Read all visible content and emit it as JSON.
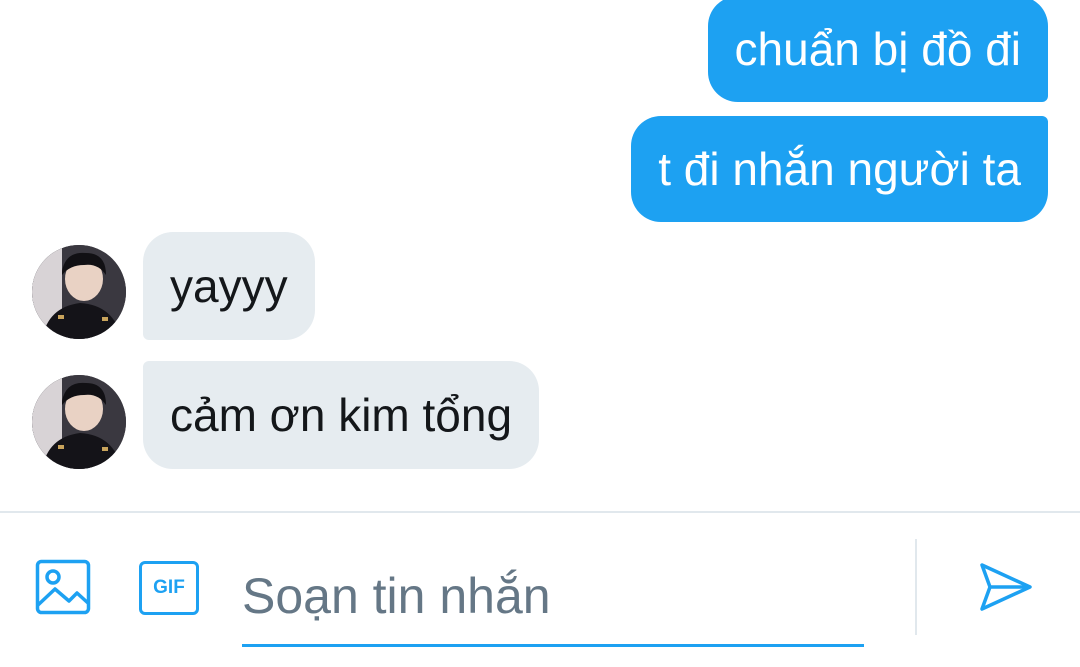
{
  "conversation": {
    "messages": [
      {
        "direction": "out",
        "text": "chuẩn bị đồ đi"
      },
      {
        "direction": "out",
        "text": "t đi nhắn người ta"
      },
      {
        "direction": "in",
        "text": "yayyy",
        "avatar": "avatar"
      },
      {
        "direction": "in",
        "text": "cảm ơn kim tổng",
        "avatar": "avatar"
      }
    ]
  },
  "composer": {
    "placeholder": "Soạn tin nhắn",
    "value": "",
    "image_icon": "image-icon",
    "gif_icon": "gif-icon",
    "gif_label": "GIF",
    "send_icon": "send-icon"
  },
  "colors": {
    "accent": "#1da1f2",
    "incoming_bubble": "#e6ecf0",
    "incoming_text": "#14171a",
    "outgoing_text": "#ffffff",
    "placeholder": "#657786",
    "divider": "#e1e8ed"
  }
}
